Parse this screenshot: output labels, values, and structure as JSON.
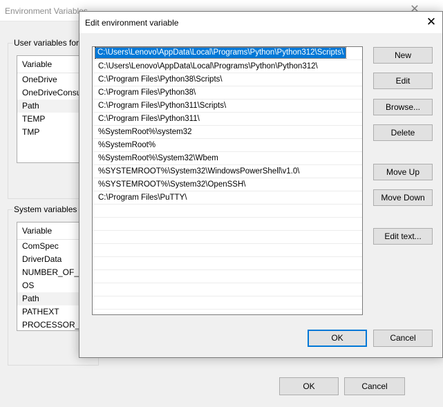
{
  "background_window": {
    "title": "Environment Variables",
    "user_group_label": "User variables for l",
    "user_list": {
      "header": "Variable",
      "rows": [
        "OneDrive",
        "OneDriveConsu",
        "Path",
        "TEMP",
        "TMP"
      ],
      "selected": "Path"
    },
    "system_group_label": "System variables",
    "system_list": {
      "header": "Variable",
      "rows": [
        "ComSpec",
        "DriverData",
        "NUMBER_OF_PI",
        "OS",
        "Path",
        "PATHEXT",
        "PROCESSOR_AR"
      ],
      "selected": "Path"
    },
    "ok_label": "OK",
    "cancel_label": "Cancel"
  },
  "dialog": {
    "title": "Edit environment variable",
    "paths": [
      "C:\\Users\\Lenovo\\AppData\\Local\\Programs\\Python\\Python312\\Scripts\\",
      "C:\\Users\\Lenovo\\AppData\\Local\\Programs\\Python\\Python312\\",
      "C:\\Program Files\\Python38\\Scripts\\",
      "C:\\Program Files\\Python38\\",
      "C:\\Program Files\\Python311\\Scripts\\",
      "C:\\Program Files\\Python311\\",
      "%SystemRoot%\\system32",
      "%SystemRoot%",
      "%SystemRoot%\\System32\\Wbem",
      "%SYSTEMROOT%\\System32\\WindowsPowerShell\\v1.0\\",
      "%SYSTEMROOT%\\System32\\OpenSSH\\",
      "C:\\Program Files\\PuTTY\\"
    ],
    "selected_index": 0,
    "buttons": {
      "new": "New",
      "edit": "Edit",
      "browse": "Browse...",
      "delete": "Delete",
      "move_up": "Move Up",
      "move_down": "Move Down",
      "edit_text": "Edit text...",
      "ok": "OK",
      "cancel": "Cancel"
    },
    "accent_color": "#0078d7"
  }
}
